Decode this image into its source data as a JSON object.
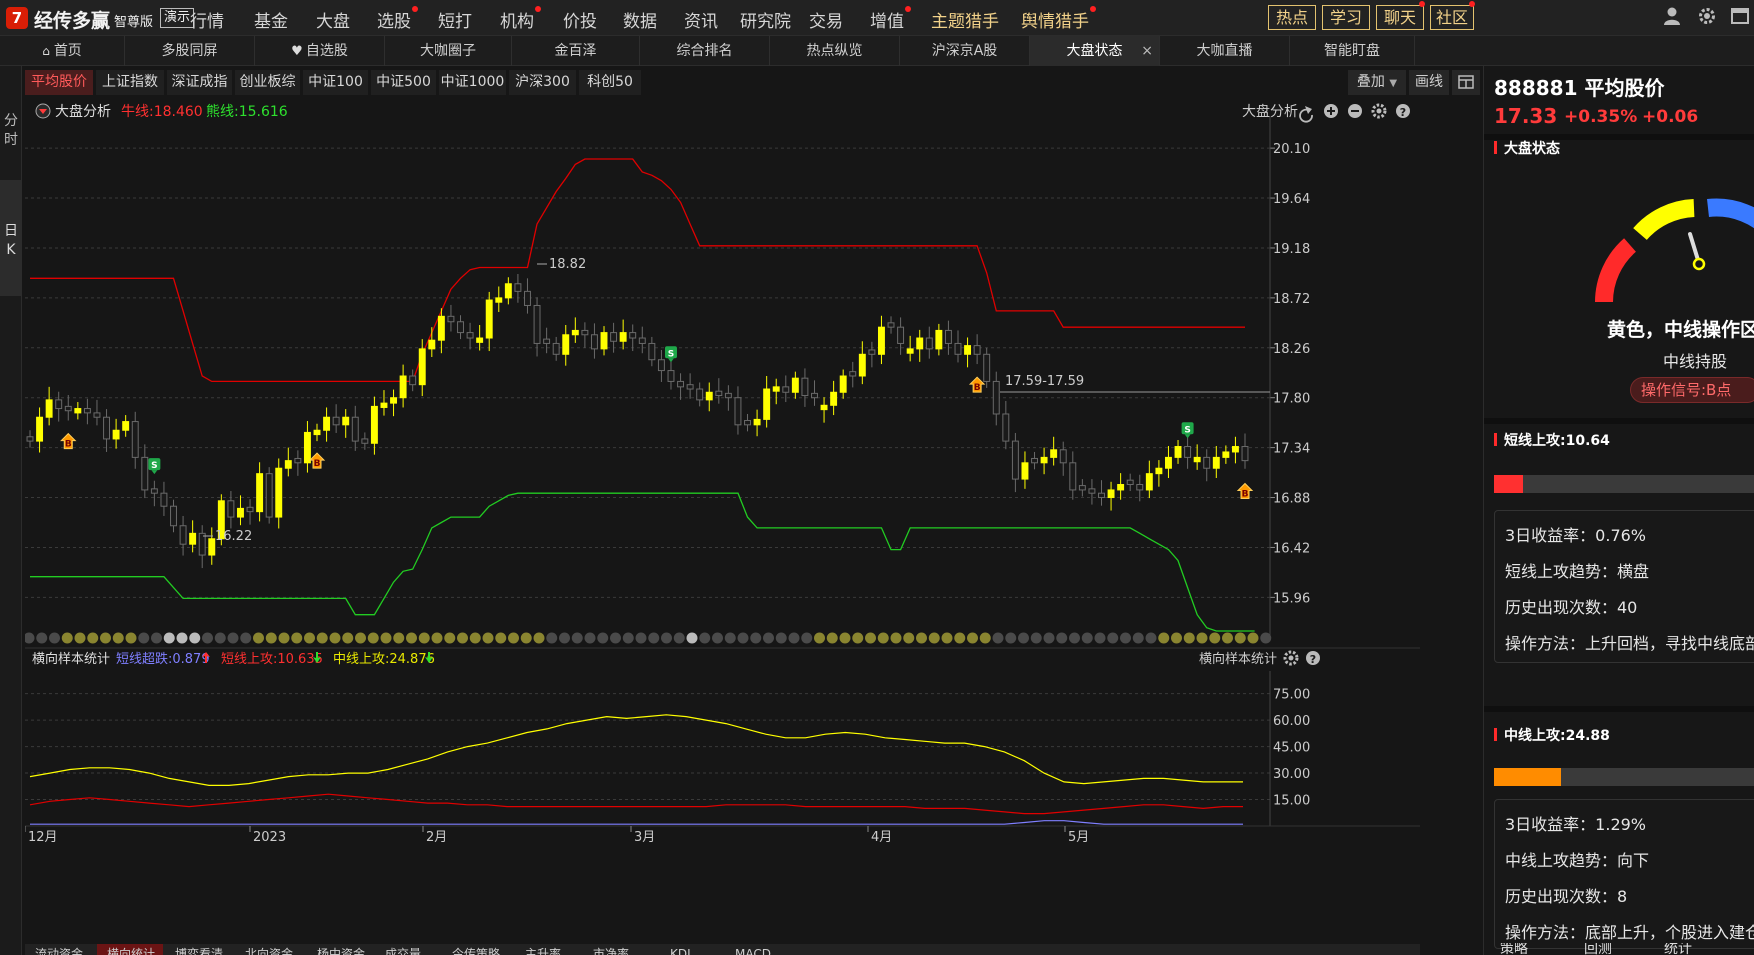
{
  "app": {
    "logo_mark": "7",
    "name": "经传多赢",
    "edition": "智尊版",
    "demo": "演示"
  },
  "nav": [
    {
      "label": "行情",
      "dot": false,
      "accent": false
    },
    {
      "label": "基金",
      "dot": false,
      "accent": false
    },
    {
      "label": "大盘",
      "dot": false,
      "accent": false
    },
    {
      "label": "选股",
      "dot": true,
      "accent": false
    },
    {
      "label": "短打",
      "dot": false,
      "accent": false
    },
    {
      "label": "机构",
      "dot": true,
      "accent": false
    },
    {
      "label": "价投",
      "dot": false,
      "accent": false
    },
    {
      "label": "数据",
      "dot": false,
      "accent": false
    },
    {
      "label": "资讯",
      "dot": false,
      "accent": false
    },
    {
      "label": "研究院",
      "dot": false,
      "accent": false
    },
    {
      "label": "交易",
      "dot": false,
      "accent": false
    },
    {
      "label": "增值",
      "dot": true,
      "accent": false
    },
    {
      "label": "主题猎手",
      "dot": false,
      "accent": true
    },
    {
      "label": "舆情猎手",
      "dot": true,
      "accent": true
    }
  ],
  "top_buttons": [
    {
      "label": "热点",
      "dot": false
    },
    {
      "label": "学习",
      "dot": false
    },
    {
      "label": "聊天",
      "dot": true
    },
    {
      "label": "社区",
      "dot": true
    }
  ],
  "top_icons": [
    "user-icon",
    "gear-icon",
    "window-icon"
  ],
  "tabs": [
    {
      "label": "首页",
      "icon": "home-icon"
    },
    {
      "label": "多股同屏"
    },
    {
      "label": "自选股",
      "icon": "heart-icon"
    },
    {
      "label": "大咖圈子"
    },
    {
      "label": "金百泽"
    },
    {
      "label": "综合排名"
    },
    {
      "label": "热点纵览"
    },
    {
      "label": "沪深京A股"
    },
    {
      "label": "大盘状态",
      "active": true,
      "close": "×"
    },
    {
      "label": "大咖直播"
    },
    {
      "label": "智能盯盘"
    }
  ],
  "left_tabs": [
    {
      "label": "分时",
      "active": false
    },
    {
      "label": "日K",
      "active": true
    }
  ],
  "index_tabs": [
    {
      "label": "平均股价",
      "active": true
    },
    {
      "label": "上证指数"
    },
    {
      "label": "深证成指"
    },
    {
      "label": "创业板综"
    },
    {
      "label": "中证100"
    },
    {
      "label": "中证500"
    },
    {
      "label": "中证1000"
    },
    {
      "label": "沪深300"
    },
    {
      "label": "科创50"
    }
  ],
  "toolbar": {
    "overlay": "叠加",
    "draw": "画线"
  },
  "main_chart": {
    "indicator": "大盘分析",
    "bull_label": "牛线:18.460",
    "bear_label": "熊线:15.616",
    "right_label": "大盘分析",
    "high_label": "18.82",
    "low_label": "16.22",
    "range_label": "17.59-17.59"
  },
  "sub_chart": {
    "indicator": "横向样本统计",
    "short_oversold": "短线超跌:0.879",
    "short_attack": "短线上攻:10.635",
    "mid_attack": "中线上攻:24.876",
    "right_label": "横向样本统计"
  },
  "colors": {
    "up": "#ffff00",
    "down": "#555555",
    "bull": "#e00000",
    "bear": "#22cc22",
    "accent_red": "#ff3b3b"
  },
  "chart_data": [
    {
      "type": "candlestick",
      "title": "",
      "x_labels": [
        "12月",
        "2023",
        "2月",
        "3月",
        "4月",
        "5月"
      ],
      "y_ticks": [
        20.1,
        19.64,
        19.18,
        18.72,
        18.26,
        17.8,
        17.34,
        16.88,
        16.42,
        15.96
      ],
      "ylim": [
        15.65,
        20.35
      ],
      "close": [
        17.4,
        17.62,
        17.78,
        17.7,
        17.68,
        17.7,
        17.66,
        17.62,
        17.42,
        17.5,
        17.58,
        17.25,
        16.95,
        16.92,
        16.8,
        16.62,
        16.45,
        16.55,
        16.35,
        16.5,
        16.85,
        16.7,
        16.78,
        16.75,
        17.1,
        16.7,
        17.15,
        17.22,
        17.2,
        17.48,
        17.5,
        17.62,
        17.55,
        17.62,
        17.4,
        17.38,
        17.72,
        17.75,
        17.8,
        18.0,
        17.92,
        18.25,
        18.33,
        18.55,
        18.5,
        18.4,
        18.35,
        18.35,
        18.7,
        18.72,
        18.85,
        18.78,
        18.65,
        18.3,
        18.3,
        18.2,
        18.38,
        18.42,
        18.38,
        18.25,
        18.4,
        18.32,
        18.4,
        18.35,
        18.3,
        18.15,
        18.05,
        17.95,
        17.9,
        17.88,
        17.78,
        17.85,
        17.82,
        17.8,
        17.55,
        17.55,
        17.6,
        17.88,
        17.9,
        17.85,
        17.98,
        17.82,
        17.8,
        17.73,
        17.85,
        18.0,
        18.0,
        18.2,
        18.2,
        18.45,
        18.45,
        18.3,
        18.25,
        18.35,
        18.25,
        18.42,
        18.3,
        18.2,
        18.28,
        18.2,
        17.95,
        17.65,
        17.4,
        17.05,
        17.2,
        17.2,
        17.25,
        17.32,
        17.2,
        16.95,
        16.95,
        16.92,
        16.88,
        16.95,
        17.0,
        17.0,
        16.95,
        17.1,
        17.15,
        17.25,
        17.35,
        17.25,
        17.25,
        17.15,
        17.25,
        17.3,
        17.35,
        17.22
      ],
      "up_flags": [
        false,
        true,
        true,
        false,
        false,
        true,
        false,
        false,
        false,
        true,
        true,
        false,
        false,
        false,
        false,
        false,
        false,
        true,
        false,
        true,
        true,
        false,
        true,
        false,
        true,
        false,
        true,
        true,
        false,
        true,
        true,
        true,
        false,
        true,
        false,
        false,
        true,
        true,
        true,
        true,
        false,
        true,
        true,
        true,
        false,
        false,
        false,
        true,
        true,
        true,
        true,
        false,
        false,
        false,
        false,
        false,
        true,
        true,
        false,
        false,
        true,
        false,
        true,
        false,
        false,
        false,
        false,
        false,
        false,
        false,
        false,
        true,
        false,
        false,
        false,
        false,
        true,
        true,
        true,
        false,
        true,
        false,
        false,
        true,
        true,
        true,
        false,
        true,
        false,
        true,
        false,
        false,
        true,
        true,
        false,
        true,
        false,
        false,
        true,
        false,
        false,
        false,
        false,
        false,
        true,
        false,
        true,
        true,
        false,
        false,
        false,
        false,
        false,
        true,
        true,
        false,
        false,
        true,
        true,
        true,
        true,
        false,
        true,
        false,
        true,
        true,
        true,
        false
      ],
      "bull_line": [
        18.9,
        18.9,
        18.9,
        18.9,
        18.9,
        18.9,
        18.9,
        18.9,
        18.9,
        18.9,
        18.9,
        18.9,
        18.9,
        18.9,
        18.9,
        18.9,
        18.6,
        18.3,
        18.0,
        17.95,
        17.95,
        17.95,
        17.95,
        17.95,
        17.95,
        17.95,
        17.95,
        17.95,
        17.95,
        17.95,
        17.95,
        17.95,
        17.95,
        17.95,
        17.95,
        17.95,
        17.95,
        17.95,
        17.95,
        17.95,
        17.95,
        18.2,
        18.4,
        18.6,
        18.8,
        18.9,
        18.98,
        19.0,
        19.0,
        19.0,
        19.0,
        19.0,
        19.0,
        19.4,
        19.55,
        19.7,
        19.82,
        19.95,
        20.0,
        20.0,
        20.0,
        20.0,
        20.0,
        20.0,
        19.88,
        19.85,
        19.8,
        19.72,
        19.6,
        19.4,
        19.2,
        19.2,
        19.2,
        19.2,
        19.2,
        19.2,
        19.2,
        19.2,
        19.2,
        19.2,
        19.2,
        19.2,
        19.2,
        19.2,
        19.2,
        19.2,
        19.2,
        19.2,
        19.2,
        19.2,
        19.2,
        19.2,
        19.2,
        19.2,
        19.2,
        19.2,
        19.2,
        19.2,
        19.2,
        19.2,
        18.95,
        18.6,
        18.6,
        18.6,
        18.6,
        18.6,
        18.6,
        18.6,
        18.45,
        18.45,
        18.45,
        18.45,
        18.45,
        18.45,
        18.45,
        18.45,
        18.45,
        18.45,
        18.45,
        18.45,
        18.45,
        18.45,
        18.45,
        18.45,
        18.45,
        18.45,
        18.45,
        18.45
      ],
      "bear_line": [
        16.15,
        16.15,
        16.15,
        16.15,
        16.15,
        16.15,
        16.15,
        16.15,
        16.15,
        16.15,
        16.15,
        16.15,
        16.15,
        16.15,
        16.15,
        16.05,
        15.95,
        15.95,
        15.95,
        15.95,
        15.95,
        15.95,
        15.95,
        15.95,
        15.95,
        15.95,
        15.95,
        15.95,
        15.95,
        15.95,
        15.95,
        15.95,
        15.95,
        15.95,
        15.8,
        15.8,
        15.8,
        15.95,
        16.1,
        16.2,
        16.22,
        16.4,
        16.6,
        16.65,
        16.7,
        16.7,
        16.7,
        16.7,
        16.8,
        16.85,
        16.9,
        16.92,
        16.92,
        16.92,
        16.92,
        16.92,
        16.92,
        16.92,
        16.92,
        16.92,
        16.92,
        16.92,
        16.92,
        16.92,
        16.92,
        16.92,
        16.92,
        16.92,
        16.92,
        16.92,
        16.92,
        16.92,
        16.92,
        16.92,
        16.92,
        16.7,
        16.6,
        16.6,
        16.6,
        16.6,
        16.6,
        16.6,
        16.6,
        16.6,
        16.6,
        16.6,
        16.6,
        16.6,
        16.6,
        16.6,
        16.4,
        16.4,
        16.6,
        16.6,
        16.6,
        16.6,
        16.6,
        16.6,
        16.6,
        16.6,
        16.6,
        16.6,
        16.6,
        16.6,
        16.6,
        16.6,
        16.6,
        16.6,
        16.6,
        16.6,
        16.6,
        16.6,
        16.6,
        16.6,
        16.6,
        16.6,
        16.55,
        16.5,
        16.45,
        16.4,
        16.3,
        16.05,
        15.8,
        15.68,
        15.65,
        15.65,
        15.65,
        15.65,
        15.65
      ],
      "signals": [
        {
          "index": 4,
          "type": "B"
        },
        {
          "index": 13,
          "type": "S"
        },
        {
          "index": 30,
          "type": "B"
        },
        {
          "index": 67,
          "type": "S"
        },
        {
          "index": 99,
          "type": "B"
        },
        {
          "index": 121,
          "type": "S"
        },
        {
          "index": 142,
          "type": "B"
        }
      ]
    },
    {
      "type": "line",
      "title": "",
      "y_ticks": [
        75.0,
        60.0,
        45.0,
        30.0,
        15.0
      ],
      "ylim": [
        0,
        85
      ],
      "series": [
        {
          "name": "短线超跌",
          "color": "#7f7fff",
          "values": [
            1,
            1,
            1,
            1,
            1,
            1,
            1,
            1,
            1,
            1,
            1,
            1,
            1,
            1,
            1,
            1,
            1,
            1,
            1,
            1,
            1,
            1,
            1,
            1,
            1,
            1,
            1,
            1,
            1,
            1,
            1,
            1,
            1,
            1,
            1,
            1,
            1,
            1,
            1,
            1,
            1,
            1,
            1,
            1,
            1,
            1,
            1,
            1,
            1,
            1,
            2,
            3,
            3,
            2,
            1,
            1,
            1,
            1,
            1,
            1,
            1,
            1
          ]
        },
        {
          "name": "短线上攻",
          "color": "#e00000",
          "values": [
            12,
            14,
            15,
            16,
            15,
            14,
            13,
            12,
            11,
            12,
            13,
            14,
            15,
            16,
            17,
            18,
            17,
            16,
            15,
            14,
            13,
            13,
            12,
            12,
            11,
            11,
            11,
            11,
            11,
            11,
            11,
            11,
            11,
            11,
            11,
            12,
            12,
            12,
            12,
            11,
            11,
            11,
            11,
            11,
            11,
            10,
            10,
            10,
            9,
            8,
            7,
            7,
            8,
            9,
            10,
            11,
            12,
            12,
            11,
            10,
            11,
            11
          ]
        },
        {
          "name": "中线上攻",
          "color": "#ffff00",
          "values": [
            28,
            30,
            32,
            33,
            33,
            32,
            30,
            27,
            25,
            23,
            23,
            24,
            26,
            28,
            29,
            29,
            30,
            30,
            32,
            35,
            38,
            42,
            45,
            47,
            50,
            53,
            55,
            58,
            60,
            62,
            61,
            62,
            63,
            62,
            60,
            58,
            55,
            52,
            50,
            50,
            52,
            53,
            52,
            50,
            49,
            48,
            47,
            47,
            45,
            42,
            37,
            30,
            25,
            24,
            25,
            26,
            27,
            27,
            26,
            25,
            25,
            25
          ]
        }
      ]
    }
  ],
  "right_panel": {
    "stock_code": "888881",
    "stock_name": "平均股价",
    "price": "17.33",
    "change_pct": "+0.35%",
    "change": "+0.06",
    "status_title": "大盘状态",
    "gauge_main": "黄色，中线操作区",
    "gauge_sub": "中线持股",
    "signal": "操作信号:B点",
    "short": {
      "title": "短线上攻:10.64",
      "level": 0.1064,
      "lines": [
        "3日收益率：0.76%",
        "短线上攻趋势：横盘",
        "历史出现次数：40",
        "操作方法：上升回档，寻找中线底部"
      ]
    },
    "mid": {
      "title": "中线上攻:24.88",
      "level": 0.2488,
      "lines": [
        "3日收益率：1.29%",
        "中线上攻趋势：向下",
        "历史出现次数：8",
        "操作方法：底部上升，个股进入建仓"
      ]
    },
    "bottom_tabs": [
      "策略",
      "回测",
      "统计"
    ]
  },
  "bottom_tabs": [
    {
      "label": "流动资金"
    },
    {
      "label": "横向统计",
      "active": true
    },
    {
      "label": "博弈看清"
    },
    {
      "label": "北向资金"
    },
    {
      "label": "杨中资金"
    },
    {
      "label": "成交量"
    },
    {
      "label": "今传策略"
    },
    {
      "label": "主升率"
    },
    {
      "label": "市净率"
    },
    {
      "label": "KDJ"
    },
    {
      "label": "MACD"
    }
  ]
}
